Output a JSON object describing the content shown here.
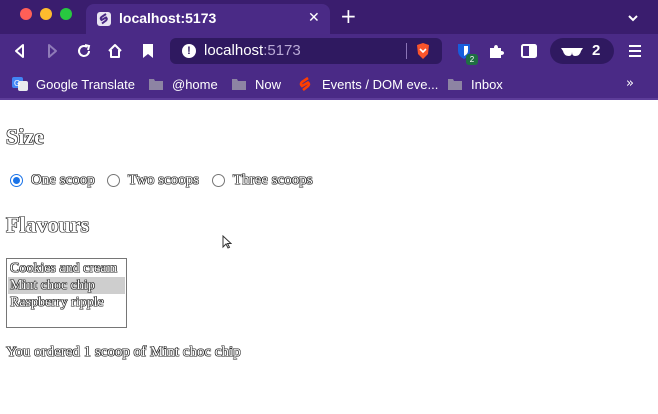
{
  "browser": {
    "tab": {
      "title": "localhost:5173",
      "close_glyph": "✕"
    },
    "new_tab_glyph": "+",
    "address": {
      "host": "localhost",
      "port": ":5173"
    },
    "extension_badge": "2",
    "private_windows_count": "2",
    "bookmarks": [
      {
        "label": "Google Translate",
        "icon": "google-translate-icon"
      },
      {
        "label": "@home",
        "icon": "folder-icon"
      },
      {
        "label": "Now",
        "icon": "folder-icon"
      },
      {
        "label": "Events / DOM eve...",
        "icon": "svelte-icon"
      },
      {
        "label": "Inbox",
        "icon": "folder-icon"
      }
    ],
    "bookmarks_more_glyph": "»",
    "accent_colors": {
      "tabbar": "#3a1d6e",
      "toolbar": "#4a2a86",
      "urlbar": "#2f1960"
    }
  },
  "page": {
    "size_heading": "Size",
    "size_options": [
      {
        "label": "One scoop",
        "checked": true
      },
      {
        "label": "Two scoops",
        "checked": false
      },
      {
        "label": "Three scoops",
        "checked": false
      }
    ],
    "flavours_heading": "Flavours",
    "flavour_options": [
      {
        "label": "Cookies and cream",
        "selected": false
      },
      {
        "label": "Mint choc chip",
        "selected": true
      },
      {
        "label": "Raspberry ripple",
        "selected": false
      }
    ],
    "order_text": "You ordered 1 scoop of Mint choc chip"
  }
}
